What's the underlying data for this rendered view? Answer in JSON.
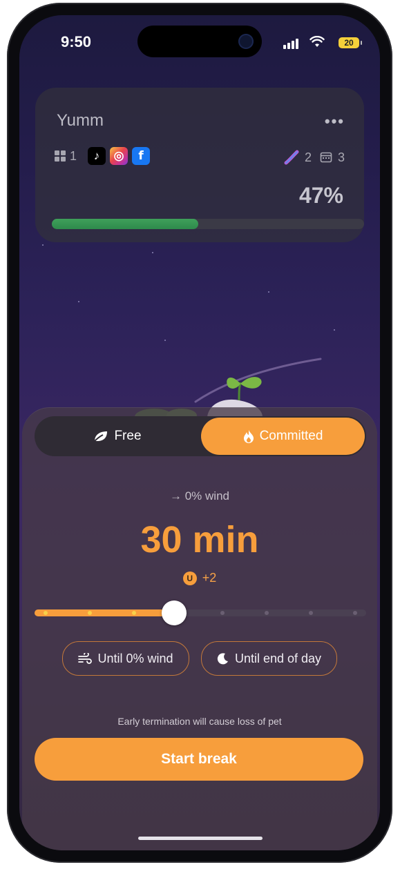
{
  "status": {
    "time": "9:50",
    "battery": "20"
  },
  "card": {
    "title": "Yumm",
    "menu": "•••",
    "apps_count": "1",
    "apps": [
      {
        "name": "tiktok-icon",
        "glyph": "♪"
      },
      {
        "name": "instagram-icon",
        "glyph": "◎"
      },
      {
        "name": "facebook-icon",
        "glyph": "f"
      }
    ],
    "streak_count": "2",
    "calendar_count": "3",
    "progress_label": "47%",
    "progress": 0.47
  },
  "mode": {
    "free_label": "Free",
    "committed_label": "Committed",
    "selected": "Committed"
  },
  "wind_text": "→ 0% wind",
  "duration": "30 min",
  "reward": {
    "coin_glyph": "U",
    "text": "+2"
  },
  "slider": {
    "value": 0.42,
    "ticks": 8
  },
  "chips": {
    "wind_label": "Until 0% wind",
    "day_label": "Until end of day"
  },
  "warning": "Early termination will cause loss of pet",
  "start_label": "Start break",
  "colors": {
    "accent": "#f79e3c",
    "progress": "#3fa05a"
  }
}
